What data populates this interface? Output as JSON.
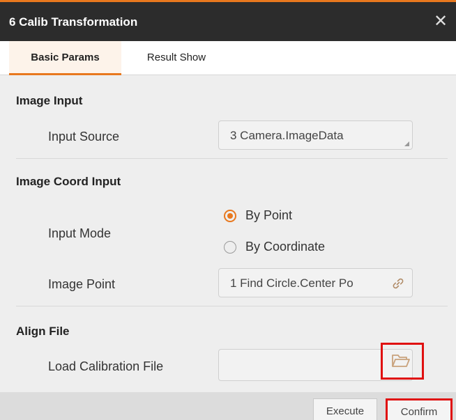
{
  "window": {
    "title": "6 Calib Transformation",
    "close_glyph": "✕",
    "accent_color": "#e8781e"
  },
  "tabs": [
    {
      "label": "Basic Params",
      "active": true
    },
    {
      "label": "Result Show",
      "active": false
    }
  ],
  "sections": {
    "image_input": {
      "title": "Image Input",
      "input_source": {
        "label": "Input Source",
        "value": "3 Camera.ImageData"
      }
    },
    "image_coord_input": {
      "title": "Image Coord Input",
      "input_mode": {
        "label": "Input Mode",
        "options": [
          {
            "label": "By Point",
            "selected": true
          },
          {
            "label": "By Coordinate",
            "selected": false
          }
        ]
      },
      "image_point": {
        "label": "Image Point",
        "value": "1 Find Circle.Center Po",
        "icon": "link-icon"
      }
    },
    "align_file": {
      "title": "Align File",
      "load_calibration_file": {
        "label": "Load Calibration File",
        "value": "",
        "icon": "folder-open-icon"
      }
    }
  },
  "footer": {
    "execute_label": "Execute",
    "confirm_label": "Confirm"
  }
}
